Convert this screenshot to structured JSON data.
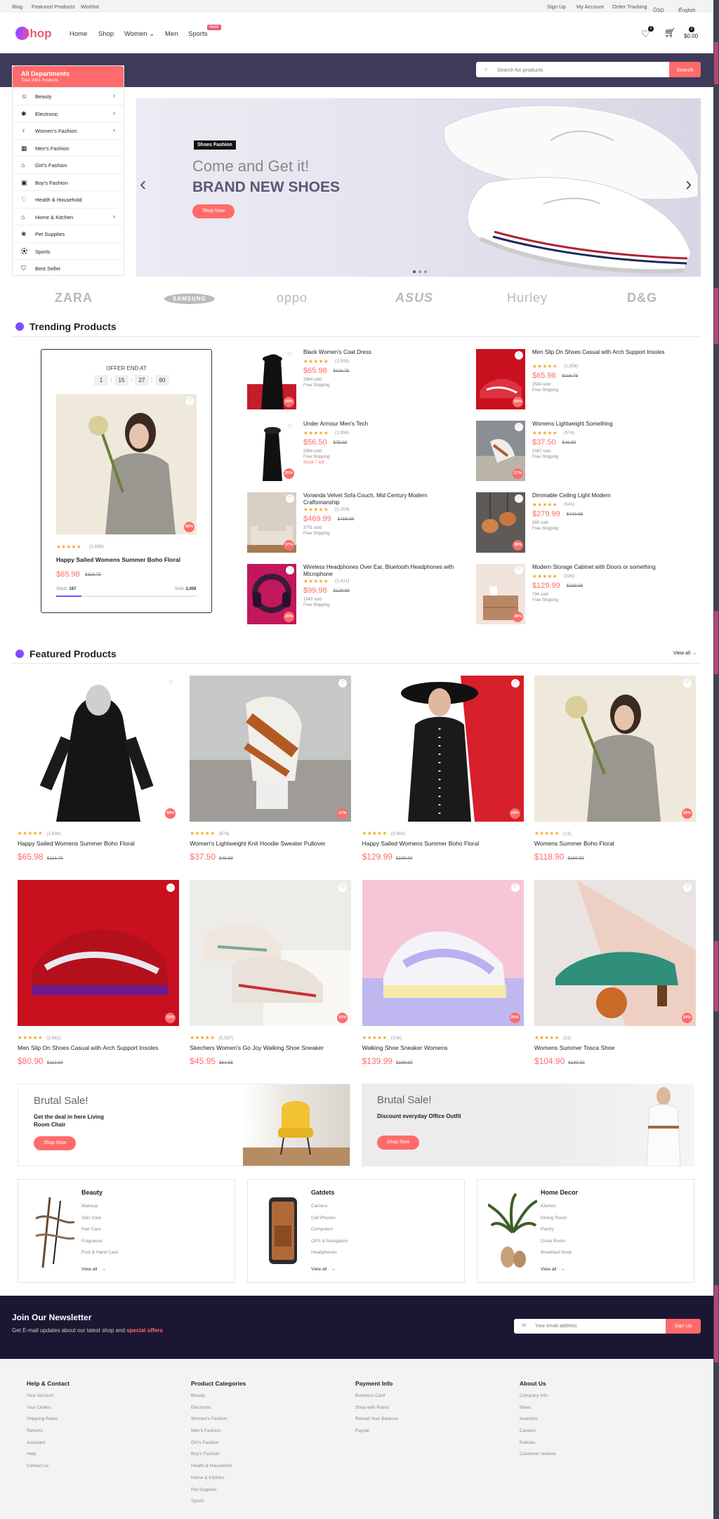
{
  "topbar": {
    "left_links": [
      "Blog",
      "Featured Products",
      "Wishlist"
    ],
    "right_links": [
      "Sign Up",
      "My Account",
      "Order Tracking"
    ],
    "currency": "USD",
    "language": "English"
  },
  "header": {
    "logo": "Shop",
    "nav": [
      "Home",
      "Shop",
      "Women",
      "Men",
      "Sports"
    ],
    "new_badge": "New!",
    "wishlist_count": "0",
    "cart_count": "0",
    "cart_total": "$0.00"
  },
  "search": {
    "placeholder": "Search for products",
    "button": "Search"
  },
  "departments": {
    "title": "All Departments",
    "subtitle": "Total 1001 Products",
    "items": [
      {
        "label": "Beauty",
        "icon": "beauty-icon",
        "chevron": true
      },
      {
        "label": "Electronic",
        "icon": "bluetooth-icon",
        "chevron": true
      },
      {
        "label": "Women's Fashion",
        "icon": "dress-icon",
        "chevron": true
      },
      {
        "label": "Men's Fashion",
        "icon": "shirt-icon",
        "chevron": false
      },
      {
        "label": "Girl's Fashion",
        "icon": "hanger-icon",
        "chevron": false
      },
      {
        "label": "Boy's Fashion",
        "icon": "tshirt-icon",
        "chevron": false
      },
      {
        "label": "Health & Household",
        "icon": "heart-icon",
        "chevron": false
      },
      {
        "label": "Home & Kitchen",
        "icon": "home-icon",
        "chevron": true
      },
      {
        "label": "Pet Supplies",
        "icon": "paw-icon",
        "chevron": false
      },
      {
        "label": "Sports",
        "icon": "ball-icon",
        "chevron": false
      },
      {
        "label": "Best Seller",
        "icon": "badge-icon",
        "chevron": false
      }
    ]
  },
  "hero": {
    "tag": "Shoes Fashion",
    "line1": "Come and Get it!",
    "line2": "BRAND NEW SHOES",
    "button": "Shop Now"
  },
  "brands": [
    "ZARA",
    "SAMSUNG",
    "oppo",
    "ASUS",
    "Hurley",
    "D&G"
  ],
  "trending": {
    "title": "Trending Products",
    "offer": {
      "label": "OFFER END AT",
      "countdown": [
        "1",
        "15",
        "27",
        "60"
      ],
      "rating_count": "(3,698)",
      "name": "Happy Sailed Womens Summer Boho Floral",
      "price": "$65.98",
      "old_price": "$116.75",
      "stock_label": "Stock:",
      "stock": "167",
      "sold_label": "Sold:",
      "sold": "3,459",
      "discount": "58%",
      "progress": 0.18
    },
    "items": [
      {
        "name": "Black Women's Coat Dress",
        "reviews": "(1,956)",
        "price": "$65.98",
        "old": "$116.75",
        "sold": "2584 sold",
        "ship": "Free Shipping",
        "extra": "",
        "disc": "50%"
      },
      {
        "name": "Men Slip On Shoes Casual with Arch Support Insoles",
        "reviews": "(1,956)",
        "price": "$65.98",
        "old": "$116.75",
        "sold": "2584 sold",
        "ship": "Free Shipping",
        "extra": "",
        "disc": "50%"
      },
      {
        "name": "Under Armour Men's Tech",
        "reviews": "(1,956)",
        "price": "$56.50",
        "old": "$75.98",
        "sold": "2584 sold",
        "ship": "Free Shipping",
        "extra": "Stock 7 left",
        "disc": "25%"
      },
      {
        "name": "Womens Lightweight Something",
        "reviews": "(974)",
        "price": "$37.50",
        "old": "$46.99",
        "sold": "1087 sold",
        "ship": "Free Shipping",
        "extra": "",
        "disc": "17%"
      },
      {
        "name": "Vonanda Velvet Sofa Couch, Mid Century Modern Craftsmanship",
        "reviews": "(1,204)",
        "price": "$469.99",
        "old": "$788.99",
        "sold": "3701 sold",
        "ship": "Free Shipping",
        "extra": "",
        "disc": "37%"
      },
      {
        "name": "Dimmable Ceiling Light Modern",
        "reviews": "(543)",
        "price": "$279.99",
        "old": "$449.99",
        "sold": "995 sold",
        "ship": "Free Shipping",
        "extra": "",
        "disc": "38%"
      },
      {
        "name": "Wireless Headphones Over Ear, Bluetooth Headphones with Microphone",
        "reviews": "(1,411)",
        "price": "$99.98",
        "old": "$129.99",
        "sold": "1843 sold",
        "ship": "Free Shipping",
        "extra": "",
        "disc": "20%"
      },
      {
        "name": "Modern Storage Cabinet with Doors or something",
        "reviews": "(336)",
        "price": "$129.99",
        "old": "$189.99",
        "sold": "794 sold",
        "ship": "Free Shipping",
        "extra": "",
        "disc": "38%"
      }
    ]
  },
  "featured": {
    "title": "Featured Products",
    "view_all": "View all",
    "items": [
      {
        "reviews": "(3,698)",
        "name": "Happy Sailed Womens Summer Boho Floral",
        "price": "$65.98",
        "old": "$116.75",
        "disc": "58%"
      },
      {
        "reviews": "(974)",
        "name": "Women's Lightweight Knit Hoodie Sweater Pullover",
        "price": "$37.50",
        "old": "$46.99",
        "disc": "17%"
      },
      {
        "reviews": "(3,469)",
        "name": "Happy Sailed Womens Summer Boho Floral",
        "price": "$129.99",
        "old": "$169.99",
        "disc": "24%"
      },
      {
        "reviews": "(13)",
        "name": "Womens Summer Boho Floral",
        "price": "$118.90",
        "old": "$160.99",
        "disc": "26%"
      },
      {
        "reviews": "(2,661)",
        "name": "Men Slip On Shoes Casual with Arch Support Insoles",
        "price": "$80.90",
        "old": "$119.99",
        "disc": "32%"
      },
      {
        "reviews": "(5,037)",
        "name": "Skechers Women's Go Joy Walking Shoe Sneaker",
        "price": "$45.95",
        "old": "$64.95",
        "disc": "30%"
      },
      {
        "reviews": "(106)",
        "name": "Walking Shoe Sneaker Womens",
        "price": "$139.99",
        "old": "$189.99",
        "disc": "26%"
      },
      {
        "reviews": "(23)",
        "name": "Womens Summer Tosca Shoe",
        "price": "$104.90",
        "old": "$180.99",
        "disc": "24%"
      }
    ]
  },
  "promos": [
    {
      "title": "Brutal Sale!",
      "sub": "Get the deal in here Living Room Chair",
      "button": "Shop Now"
    },
    {
      "title": "Brutal Sale!",
      "sub": "Discount everyday Office Outfit",
      "button": "Shop Now"
    }
  ],
  "categories": [
    {
      "title": "Beauty",
      "links": [
        "Makeup",
        "Skin Care",
        "Hair Care",
        "Fragrance",
        "Foot & Hand Care"
      ],
      "view": "View all"
    },
    {
      "title": "Gatdets",
      "links": [
        "Camera",
        "Cell Phones",
        "Computers",
        "GPS & Navigation",
        "Headphones"
      ],
      "view": "View all"
    },
    {
      "title": "Home Decor",
      "links": [
        "Kitchen",
        "Dining Room",
        "Pantry",
        "Great Room",
        "Breakfast Nook"
      ],
      "view": "View all"
    }
  ],
  "newsletter": {
    "title": "Join Our Newsletter",
    "text": "Get E-mail updates about our latest shop and ",
    "highlight": "special offers",
    "placeholder": "Your email address",
    "button": "Sign Up"
  },
  "footer": [
    {
      "title": "Help & Contact",
      "links": [
        "Your Account",
        "Your Orders",
        "Shipping Rates",
        "Returns",
        "Assistant",
        "Help",
        "Contact us"
      ]
    },
    {
      "title": "Product Categories",
      "links": [
        "Beauty",
        "Electronic",
        "Women's Fashion",
        "Men's Fashion",
        "Girl's Fashion",
        "Boy's Fashion",
        "Health & Household",
        "Home & Kitchen",
        "Pet Supplies",
        "Sports"
      ]
    },
    {
      "title": "Payment Info",
      "links": [
        "Business Card",
        "Shop with Points",
        "Reload Your Balance",
        "Paypal"
      ]
    },
    {
      "title": "About Us",
      "links": [
        "Company info",
        "News",
        "Investors",
        "Careers",
        "Policies",
        "Customer reviews"
      ]
    }
  ],
  "colors": {
    "accent": "#ff6b6b",
    "purple": "#7c4dff",
    "band": "#3e3a5a",
    "newsletter": "#1b1631"
  }
}
